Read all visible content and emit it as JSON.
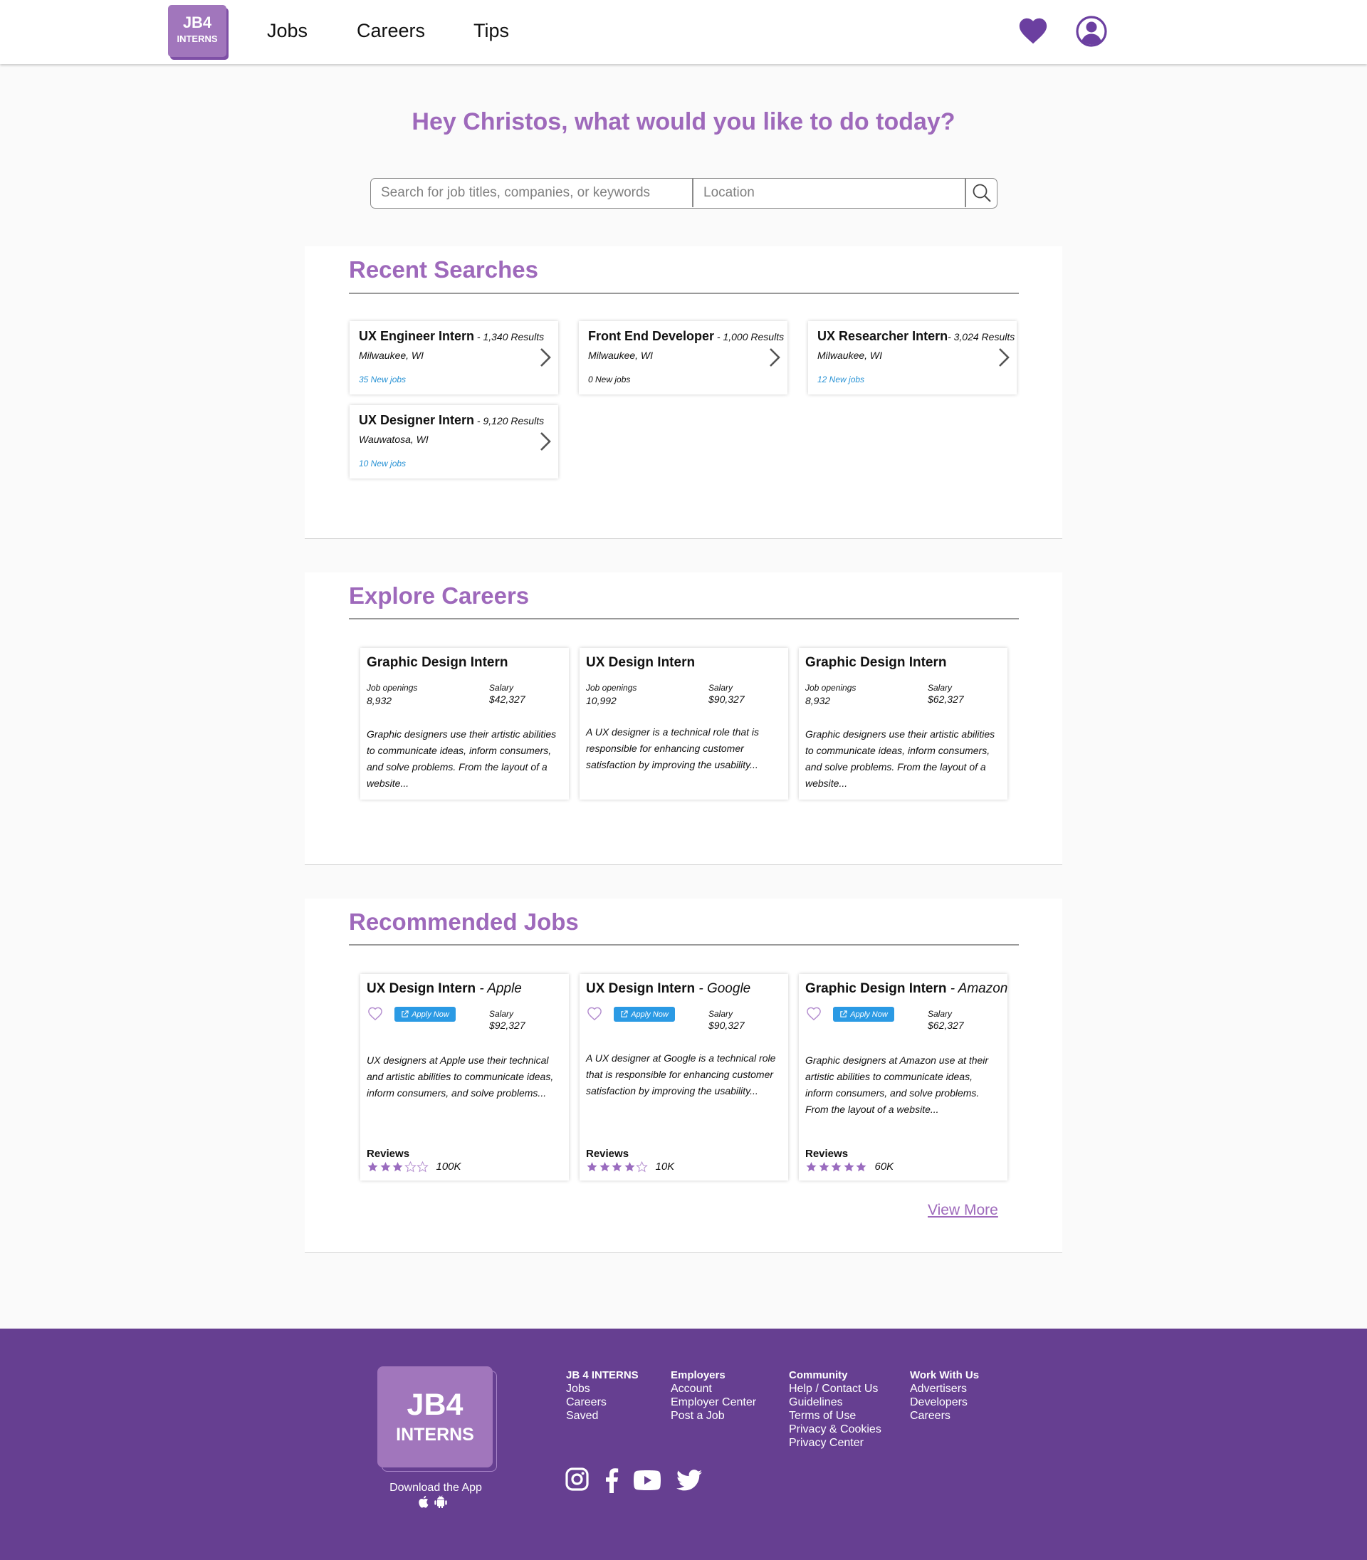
{
  "header": {
    "logo_line1": "JB4",
    "logo_line2": "INTERNS",
    "nav": [
      "Jobs",
      "Careers",
      "Tips"
    ]
  },
  "greeting": "Hey Christos, what would you like to do today?",
  "search": {
    "keywords_placeholder": "Search for job titles, companies, or keywords",
    "location_placeholder": "Location"
  },
  "recent_searches": {
    "title": "Recent Searches",
    "items": [
      {
        "title": "UX Engineer Intern",
        "results": " - 1,340 Results",
        "location": "Milwaukee, WI",
        "new_jobs": "35 New jobs"
      },
      {
        "title": "Front End Developer",
        "results": " - 1,000 Results",
        "location": "Milwaukee, WI",
        "new_jobs": "0 New jobs"
      },
      {
        "title": "UX Researcher Intern",
        "results": "- 3,024 Results",
        "location": "Milwaukee, WI",
        "new_jobs": "12 New jobs"
      },
      {
        "title": "UX Designer Intern",
        "results": " - 9,120 Results",
        "location": "Wauwatosa, WI",
        "new_jobs": "10 New jobs"
      }
    ]
  },
  "explore_careers": {
    "title": "Explore Careers",
    "openings_label": "Job openings",
    "salary_label": "Salary",
    "items": [
      {
        "title": "Graphic Design Intern",
        "openings": "8,932",
        "salary": "$42,327",
        "description": "Graphic designers use their artistic abilities to communicate ideas, inform consumers, and solve problems. From the layout of a website..."
      },
      {
        "title": "UX Design Intern",
        "openings": "10,992",
        "salary": "$90,327",
        "description": "A UX designer is a technical role that is responsible for enhancing customer satisfaction by improving the usability..."
      },
      {
        "title": "Graphic Design Intern",
        "openings": "8,932",
        "salary": "$62,327",
        "description": "Graphic designers use their artistic abilities to communicate ideas, inform consumers, and solve problems. From the layout of a website..."
      }
    ]
  },
  "recommended_jobs": {
    "title": "Recommended Jobs",
    "apply_label": "Apply Now",
    "salary_label": "Salary",
    "reviews_label": "Reviews",
    "view_more": "View More",
    "items": [
      {
        "title": "UX Design Intern",
        "company": " - Apple",
        "salary": "$92,327",
        "description": "UX designers at Apple use their technical and artistic abilities to communicate ideas, inform consumers, and solve problems...",
        "rating": 3,
        "reviews": "100K"
      },
      {
        "title": "UX Design Intern",
        "company": " - Google",
        "salary": "$90,327",
        "description": "A UX designer at Google is a technical role that is responsible for enhancing customer satisfaction by improving the usability...",
        "rating": 4,
        "reviews": "10K"
      },
      {
        "title": "Graphic Design Intern",
        "company": " - Amazon",
        "salary": "$62,327",
        "description": "Graphic designers at Amazon use at their artistic abilities to communicate ideas, inform consumers, and solve problems. From the layout of a website...",
        "rating": 5,
        "reviews": "60K"
      }
    ]
  },
  "footer": {
    "logo_line1": "JB4",
    "logo_line2": "INTERNS",
    "download": "Download the App",
    "columns": [
      {
        "heading": "JB 4 INTERNS",
        "links": [
          "Jobs",
          "Careers",
          "Saved"
        ]
      },
      {
        "heading": "Employers",
        "links": [
          "Account",
          "Employer Center",
          "Post a Job"
        ]
      },
      {
        "heading": "Community",
        "links": [
          "Help / Contact Us",
          "Guidelines",
          "Terms of Use",
          "Privacy & Cookies",
          "Privacy Center"
        ]
      },
      {
        "heading": "Work With Us",
        "links": [
          "Advertisers",
          "Developers",
          "Careers"
        ]
      }
    ],
    "social_icons": [
      "instagram-icon",
      "facebook-icon",
      "youtube-icon",
      "twitter-icon"
    ]
  },
  "colors": {
    "brand_purple": "#663f91",
    "heading_purple": "#9e69bb",
    "logo_purple": "#a176bc",
    "icon_purple": "#6b3fa0",
    "apply_blue": "#2b9ae4",
    "link_blue": "#2a93d5",
    "star_purple": "#9a6cbf"
  }
}
